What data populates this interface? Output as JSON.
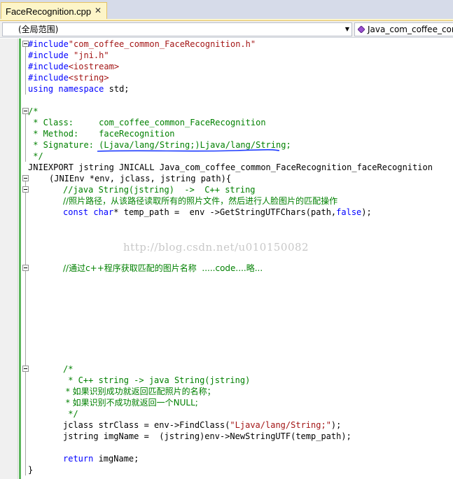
{
  "tab": {
    "title": "FaceRecognition.cpp",
    "close_glyph": "✕"
  },
  "navbar": {
    "scope": "(全局范围)",
    "member": "Java_com_coffee_com"
  },
  "watermark": "http://blog.csdn.net/u010150082",
  "code": {
    "l1_kw": "#include",
    "l1_str": "\"com_coffee_common_FaceRecognition.h\"",
    "l2_kw": "#include",
    "l2_str": " \"jni.h\"",
    "l3_kw": "#include",
    "l3_str": "<iostream>",
    "l4_kw": "#include",
    "l4_str": "<string>",
    "l5_kw1": "using",
    "l5_kw2": "namespace",
    "l5_rest": " std;",
    "c1": "/*",
    "c2": " * Class:     com_coffee_common_FaceRecognition",
    "c3": " * Method:    faceRecognition",
    "c4": " * Signature: (Ljava/lang/String;)Ljava/lang/String;",
    "c5": " */",
    "sig1": "JNIEXPORT jstring JNICALL Java_com_coffee_common_FaceRecognition_faceRecognition",
    "sig2": "(JNIEnv *env, jclass, jstring path){",
    "b1": "//java String(jstring)  ->  C++ string",
    "b2": "//照片路径，从该路径读取所有的照片文件，然后进行人脸图片的匹配操作",
    "b3_kw1": "const",
    "b3_kw2": "char",
    "b3_mid": "* temp_path =  env ->GetStringUTFChars(path,",
    "b3_kw3": "false",
    "b3_end": ");",
    "b4": "//通过c++程序获取匹配的图片名称  .....code....略...",
    "d1": "/*",
    "d2": " * C++ string -> java String(jstring)",
    "d3": " * 如果识别成功就返回匹配照片的名称；",
    "d4": " * 如果识别不成功就返回一个NULL;",
    "d5": " */",
    "e1_a": "jclass strClass = env->FindClass(",
    "e1_str": "\"Ljava/lang/String;\"",
    "e1_b": ");",
    "e2": "jstring imgName =  (jstring)env->NewStringUTF(temp_path);",
    "e3_kw": "return",
    "e3_rest": " imgName;",
    "close": "}"
  },
  "colors": {
    "keyword": "#0000ff",
    "string": "#a31515",
    "comment": "#008000",
    "annotation_underline": "#1e3cff",
    "change_bar": "#5bb55b"
  }
}
